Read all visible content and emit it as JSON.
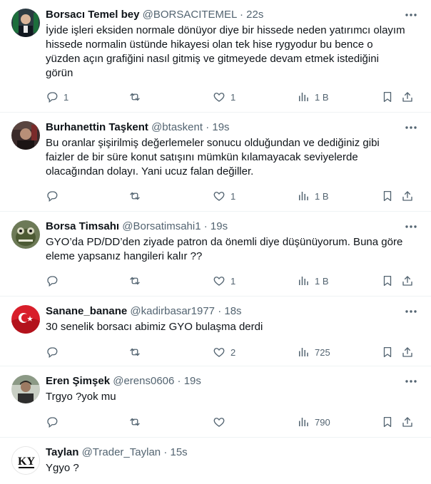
{
  "tweets": [
    {
      "name": "Borsacı Temel bey",
      "handle": "@BORSACITEMEL",
      "dot": "·",
      "time": "22s",
      "text": "İyide işleri eksiden normale dönüyor diye bir hissede neden yatırımcı olayım\nhissede normalin üstünde hikayesi olan tek hise rygyodur bu bence o\nyüzden açın grafiğini nasıl gitmiş ve gitmeyede devam etmek istediğini\ngörün",
      "replies": "1",
      "retweets": "",
      "likes": "1",
      "views": "1 B"
    },
    {
      "name": "Burhanettin Taşkent",
      "handle": "@btaskent",
      "dot": "·",
      "time": "19s",
      "text": "Bu oranlar şişirilmiş değerlemeler sonucu olduğundan ve dediğiniz gibi\nfaizler de bir süre konut satışını mümkün kılamayacak seviyelerde\nolacağından dolayı. Yani ucuz falan değiller.",
      "replies": "",
      "retweets": "",
      "likes": "1",
      "views": "1 B"
    },
    {
      "name": "Borsa Timsahı",
      "handle": "@Borsatimsahi1",
      "dot": "·",
      "time": "19s",
      "text": "GYO’da PD/DD’den ziyade patron da önemli diye düşünüyorum. Buna göre\neleme yapsanız hangileri kalır ??",
      "replies": "",
      "retweets": "",
      "likes": "1",
      "views": "1 B"
    },
    {
      "name": "Sanane_banane",
      "handle": "@kadirbasar1977",
      "dot": "·",
      "time": "18s",
      "text": "30 senelik borsacı abimiz GYO bulaşma derdi",
      "replies": "",
      "retweets": "",
      "likes": "2",
      "views": "725"
    },
    {
      "name": "Eren Şimşek",
      "handle": "@erens0606",
      "dot": "·",
      "time": "19s",
      "text": "Trgyo ?yok mu",
      "replies": "",
      "retweets": "",
      "likes": "",
      "views": "790"
    },
    {
      "name": "Taylan",
      "handle": "@Trader_Taylan",
      "dot": "·",
      "time": "15s",
      "text": "Ygyo ?",
      "logo_text": "KY"
    }
  ],
  "icons": {
    "reply": "reply-icon",
    "retweet": "retweet-icon",
    "like": "heart-icon",
    "views": "views-icon",
    "bookmark": "bookmark-icon",
    "share": "share-icon",
    "more": "more-icon"
  },
  "colors": {
    "text": "#0f1419",
    "secondary": "#536471",
    "divider": "#eff3f4"
  }
}
